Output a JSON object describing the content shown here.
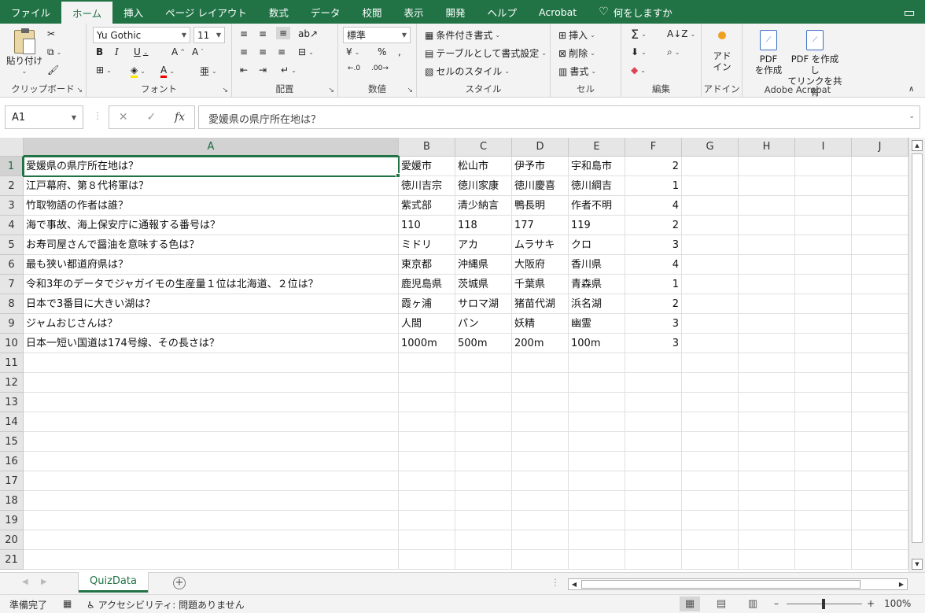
{
  "tabs": [
    "ファイル",
    "ホーム",
    "挿入",
    "ページ レイアウト",
    "数式",
    "データ",
    "校閲",
    "表示",
    "開発",
    "ヘルプ",
    "Acrobat"
  ],
  "active_tab": "ホーム",
  "tell_me": "何をしますか",
  "ribbon": {
    "clipboard": {
      "paste": "貼り付け",
      "label": "クリップボード"
    },
    "font": {
      "name": "Yu Gothic",
      "size": "11",
      "label": "フォント"
    },
    "alignment": {
      "label": "配置"
    },
    "number": {
      "format": "標準",
      "label": "数値"
    },
    "styles": {
      "conditional": "条件付き書式",
      "table": "テーブルとして書式設定",
      "cell_styles": "セルのスタイル",
      "label": "スタイル"
    },
    "cells": {
      "insert": "挿入",
      "delete": "削除",
      "format": "書式",
      "label": "セル"
    },
    "editing": {
      "label": "編集"
    },
    "addins": {
      "btn1": "アド",
      "btn2": "イン",
      "label": "アドイン"
    },
    "acrobat": {
      "pdf1a": "PDF",
      "pdf1b": "を作成",
      "pdf2a": "PDF を作成し",
      "pdf2b": "てリンクを共有",
      "label": "Adobe Acrobat"
    }
  },
  "formula_bar": {
    "name_box": "A1",
    "fx": "fx",
    "content": "愛媛県の県庁所在地は？"
  },
  "columns": [
    "A",
    "B",
    "C",
    "D",
    "E",
    "F",
    "G",
    "H",
    "I",
    "J"
  ],
  "rows": [
    [
      "愛媛県の県庁所在地は？",
      "愛媛市",
      "松山市",
      "伊予市",
      "宇和島市",
      "2"
    ],
    [
      "江戸幕府、第８代将軍は？",
      "徳川吉宗",
      "徳川家康",
      "徳川慶喜",
      "徳川綱吉",
      "1"
    ],
    [
      "竹取物語の作者は誰？",
      "紫式部",
      "清少納言",
      "鴨長明",
      "作者不明",
      "4"
    ],
    [
      "海で事故、海上保安庁に通報する番号は？",
      "110",
      "118",
      "177",
      "119",
      "2"
    ],
    [
      "お寿司屋さんで醤油を意味する色は？",
      "ミドリ",
      "アカ",
      "ムラサキ",
      "クロ",
      "3"
    ],
    [
      "最も狭い都道府県は？",
      "東京都",
      "沖縄県",
      "大阪府",
      "香川県",
      "4"
    ],
    [
      "令和3年のデータでジャガイモの生産量１位は北海道、２位は？",
      "鹿児島県",
      "茨城県",
      "千葉県",
      "青森県",
      "1"
    ],
    [
      "日本で3番目に大きい湖は？",
      "霞ヶ浦",
      "サロマ湖",
      "猪苗代湖",
      "浜名湖",
      "2"
    ],
    [
      "ジャムおじさんは？",
      "人間",
      "パン",
      "妖精",
      "幽霊",
      "3"
    ],
    [
      "日本一短い国道は174号線、その長さは？",
      "1000m",
      "500m",
      "200m",
      "100m",
      "3"
    ]
  ],
  "row_numbers": [
    "1",
    "2",
    "3",
    "4",
    "5",
    "6",
    "7",
    "8",
    "9",
    "10",
    "11",
    "12",
    "13",
    "14",
    "15",
    "16",
    "17",
    "18",
    "19",
    "20",
    "21"
  ],
  "sheet_tab": "QuizData",
  "status": {
    "ready": "準備完了",
    "accessibility": "アクセシビリティ: 問題ありません",
    "zoom": "100%"
  },
  "accent_color": "#217346"
}
